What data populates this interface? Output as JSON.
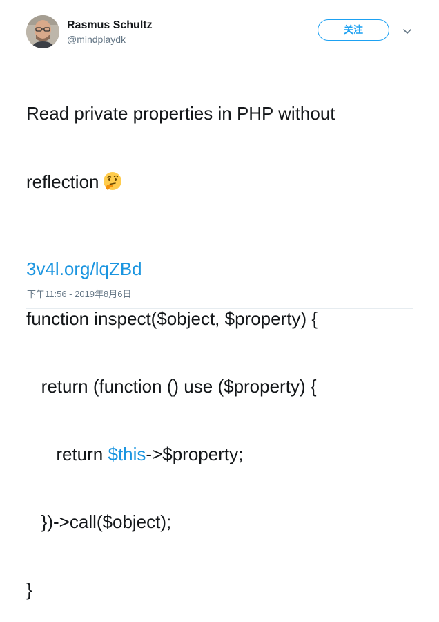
{
  "author": {
    "name": "Rasmus Schultz",
    "handle": "@mindplaydk"
  },
  "follow_label": "关注",
  "icons": {
    "more": "chevron-down-icon",
    "emoji": "thinking-face-emoji"
  },
  "tweet": {
    "line1": "Read private properties in PHP without",
    "line2": "reflection",
    "code": {
      "line1": "function inspect($object, $property) {",
      "line2": "return (function () use ($property) {",
      "line3_kw": "return ",
      "line3_var": "$this",
      "line3_rest": "->$property;",
      "line4": "})->call($object);",
      "line5": "}"
    },
    "link": "3v4l.org/lqZBd",
    "timestamp": "下午11:56 - 2019年8月6日"
  },
  "colors": {
    "link_blue": "#1b95e0",
    "follow_blue": "#1da1f2",
    "text": "#14171a",
    "muted": "#657786"
  }
}
